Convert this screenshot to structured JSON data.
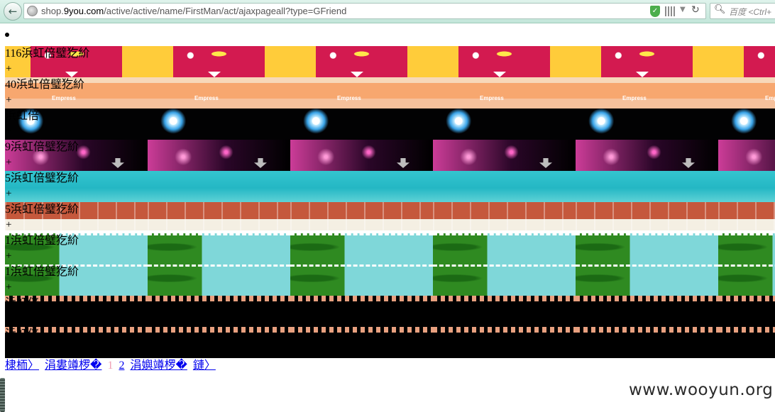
{
  "browser": {
    "url_prefix": "shop.",
    "url_domain": "9you.com",
    "url_path": "/active/active/name/FirstMan/act/ajaxpageall?type=GFriend",
    "search_placeholder": "百度 <Ctrl+"
  },
  "rows": [
    {
      "label": "116浜虹倍璧犵紒",
      "plus": "+"
    },
    {
      "label": "40浜虹倍璧犵紒",
      "plus": "+"
    },
    {
      "label": "浜虹倍",
      "plus": "+"
    },
    {
      "label": "9浜虹倍璧犵紒",
      "plus": "+"
    },
    {
      "label": "5浜虹倍璧犵紒",
      "plus": "+"
    },
    {
      "label": "5浜虹倍璧犵紒",
      "plus": "+"
    },
    {
      "label": "1浜虹倍璧犵紒",
      "plus": "+"
    },
    {
      "label": "1浜虹倍璧犵紒",
      "plus": "+"
    },
    {
      "label": "浜虹倍",
      "plus": "+"
    },
    {
      "label": "浜虹倍",
      "plus": "+"
    }
  ],
  "pager": {
    "first": "棣栭〉",
    "prev": "涓婁竴椤�",
    "current": "1",
    "page2": "2",
    "next": "涓嬩竴椤�",
    "last": "鏈〉"
  },
  "watermark": "www.wooyun.org"
}
